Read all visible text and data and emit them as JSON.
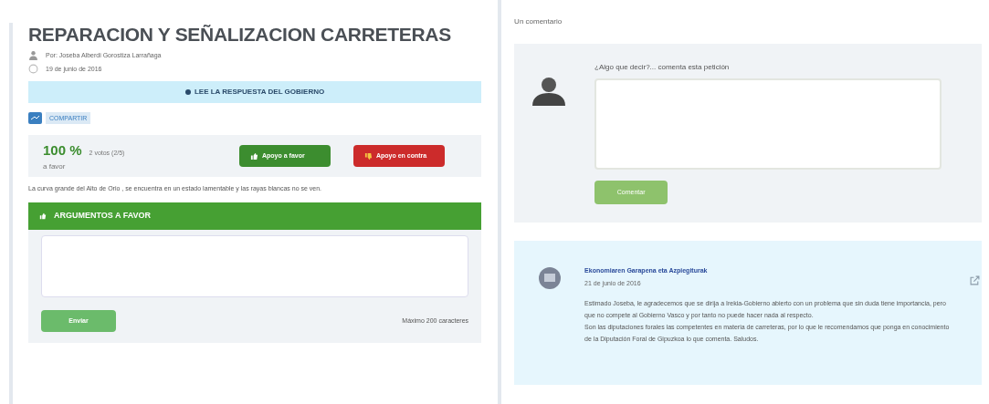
{
  "petition": {
    "title": "REPARACION Y SEÑALIZACION CARRETERAS",
    "author": "Por: Joseba Alberdi Gorostiza Larrañaga",
    "date": "19 de junio de 2016",
    "response_banner": "LEE LA RESPUESTA DEL GOBIERNO",
    "share_button": "COMPARTIR",
    "support": {
      "percent": "100 %",
      "votes": "2 votos (2/5)",
      "caption": "a favor"
    },
    "vote_buttons": [
      {
        "label": "Apoyo a favor",
        "kind": "favor"
      },
      {
        "label": "Apoyo en contra",
        "kind": "contra"
      }
    ],
    "description": "La curva grande del Alto de Orio , se encuentra en un estado lamentable y las rayas blancas no se ven.",
    "arguments": {
      "heading": "ARGUMENTOS A FAVOR",
      "submit": "Enviar",
      "limit": "Máximo 200 caracteres"
    }
  },
  "comments": {
    "count": "Un comentario",
    "form": {
      "label": "¿Algo que decir?... comenta esta petición",
      "submit": "Comentar"
    },
    "items": [
      {
        "author": "Ekonomiaren Garapena eta Azpiegiturak",
        "date": "21 de junio de 2016",
        "paragraphs": [
          "Estimado Joseba, le agradecemos que se dirija a Irekia-Gobierno abierto con un problema que sin duda tiene importancia, pero que no compete al Gobierno Vasco y por tanto no puede hacer nada al respecto.",
          "Son las diputaciones forales las competentes en materia de carreteras, por lo que le recomendamos que ponga en conocimiento de la Diputación Foral de Gipuzkoa lo que comenta. Saludos."
        ]
      }
    ]
  }
}
